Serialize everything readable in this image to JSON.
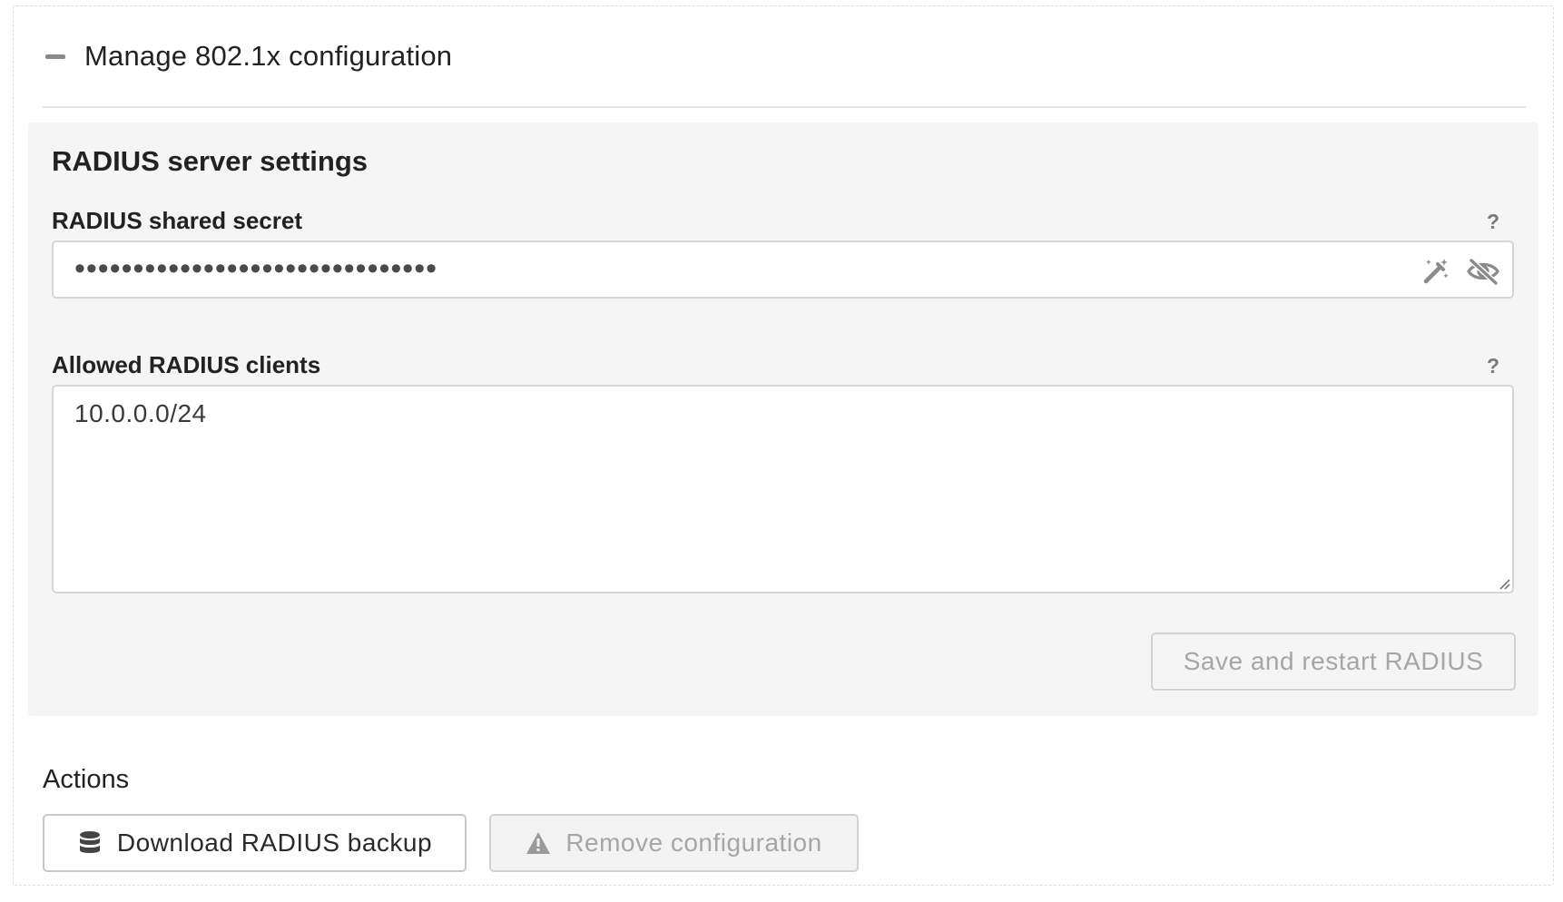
{
  "header": {
    "title": "Manage 802.1x configuration",
    "collapse_icon": "minus-icon"
  },
  "radius": {
    "section_title": "RADIUS server settings",
    "secret": {
      "label": "RADIUS shared secret",
      "help": "?",
      "masked_value": "•••••••••••••••••••••••••••••••",
      "icons": [
        "magic-wand-icon",
        "eye-slash-icon"
      ]
    },
    "clients": {
      "label": "Allowed RADIUS clients",
      "help": "?",
      "value": "10.0.0.0/24"
    },
    "save_button": "Save and restart RADIUS"
  },
  "actions": {
    "title": "Actions",
    "download_button": "Download RADIUS backup",
    "download_icon": "database-icon",
    "remove_button": "Remove configuration",
    "remove_icon": "warning-icon"
  },
  "colors": {
    "settings_background": "#f5f5f5",
    "disabled_text": "#a6a6a6",
    "icon_gray": "#7a7a7a"
  }
}
